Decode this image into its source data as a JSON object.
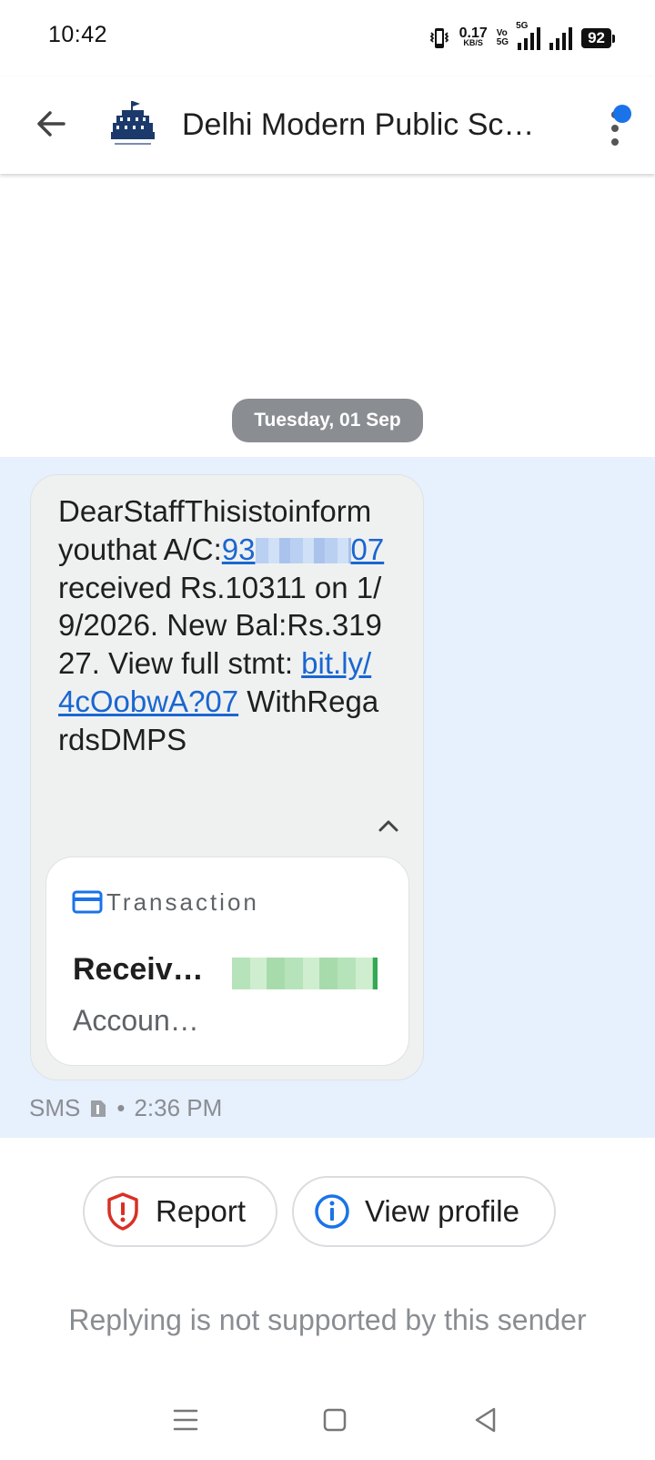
{
  "status_bar": {
    "time": "10:42",
    "net_speed_value": "0.17",
    "net_speed_unit": "KB/S",
    "volte_top": "Vo",
    "volte_bottom": "5G",
    "network": "5G",
    "battery": "92"
  },
  "header": {
    "title": "Delhi Modern Public Sc…"
  },
  "conversation": {
    "date_chip": "Tuesday, 01 Sep",
    "message": {
      "text_before_account": "DearStaffThisistoinformyouthat A/C:",
      "account_link": "93",
      "account_link_end": "07",
      "text_middle": " received Rs.10311 on 1/9/2026. New Bal:Rs.31927. View full stmt: ",
      "short_link": "bit.ly/4cOobwA?07",
      "text_after": " WithRegardsDMPS"
    },
    "card": {
      "label": "Transaction",
      "title": "Receiv…",
      "subtitle": "Accoun…"
    },
    "meta": {
      "type": "SMS",
      "separator": "•",
      "time": "2:36 PM"
    }
  },
  "actions": {
    "report_label": "Report",
    "view_profile_label": "View profile"
  },
  "footer": {
    "no_reply_text": "Replying is not supported by this sender"
  },
  "colors": {
    "accent": "#1a73e8",
    "link": "#1a66d1",
    "message_area": "#e7f0fd",
    "bubble": "#eff1f1",
    "report_red": "#d93025",
    "transaction_green": "#34a853"
  }
}
